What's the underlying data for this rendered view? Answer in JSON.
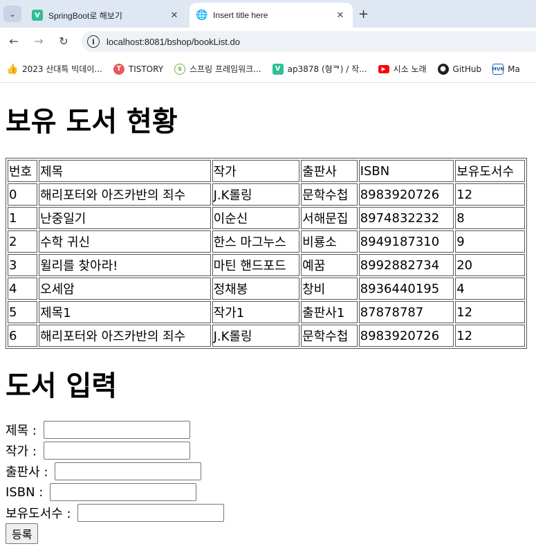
{
  "browser": {
    "tabs": [
      {
        "title": "SpringBoot로 해보기",
        "favicon": "v-icon"
      },
      {
        "title": "Insert title here",
        "favicon": "globe-icon"
      }
    ],
    "new_tab_label": "+",
    "url": "localhost:8081/bshop/bookList.do",
    "bookmarks": [
      {
        "label": "2023 산대특 빅데이...",
        "icon": "thumbs-up-icon",
        "color": "#f5b400"
      },
      {
        "label": "TISTORY",
        "icon": "tistory-icon",
        "color": "#eb5757"
      },
      {
        "label": "스프링 프레임워크...",
        "icon": "spring-icon",
        "color": "#6db33f"
      },
      {
        "label": "ap3878 (형ᄏ) / 작...",
        "icon": "v-icon",
        "color": "#2fbf94"
      },
      {
        "label": "시소 노래",
        "icon": "youtube-icon",
        "color": "#ff0000"
      },
      {
        "label": "GitHub",
        "icon": "github-icon",
        "color": "#1f1f1f"
      },
      {
        "label": "Ma",
        "icon": "mvn-icon",
        "color": "#1f5fa8"
      }
    ]
  },
  "page": {
    "title": "보유 도서 현황",
    "table": {
      "headers": [
        "번호",
        "제목",
        "작가",
        "출판사",
        "ISBN",
        "보유도서수"
      ],
      "rows": [
        [
          "0",
          "해리포터와 아즈카반의 죄수",
          "J.K롤링",
          "문학수첩",
          "8983920726",
          "12"
        ],
        [
          "1",
          "난중일기",
          "이순신",
          "서해문집",
          "8974832232",
          "8"
        ],
        [
          "2",
          "수학 귀신",
          "한스 마그누스",
          "비룡소",
          "8949187310",
          "9"
        ],
        [
          "3",
          "윌리를 찾아라!",
          "마틴 핸드포드",
          "예꿈",
          "8992882734",
          "20"
        ],
        [
          "4",
          "오세암",
          "정채봉",
          "창비",
          "8936440195",
          "4"
        ],
        [
          "5",
          "제목1",
          "작가1",
          "출판사1",
          "87878787",
          "12"
        ],
        [
          "6",
          "해리포터와 아즈카반의 죄수",
          "J.K롤링",
          "문학수첩",
          "8983920726",
          "12"
        ]
      ]
    },
    "form": {
      "title": "도서 입력",
      "fields": [
        {
          "label": "제목 : ",
          "value": ""
        },
        {
          "label": "작가 : ",
          "value": ""
        },
        {
          "label": "출판사 : ",
          "value": ""
        },
        {
          "label": "ISBN : ",
          "value": ""
        },
        {
          "label": "보유도서수 : ",
          "value": ""
        }
      ],
      "submit_label": "등록"
    }
  }
}
